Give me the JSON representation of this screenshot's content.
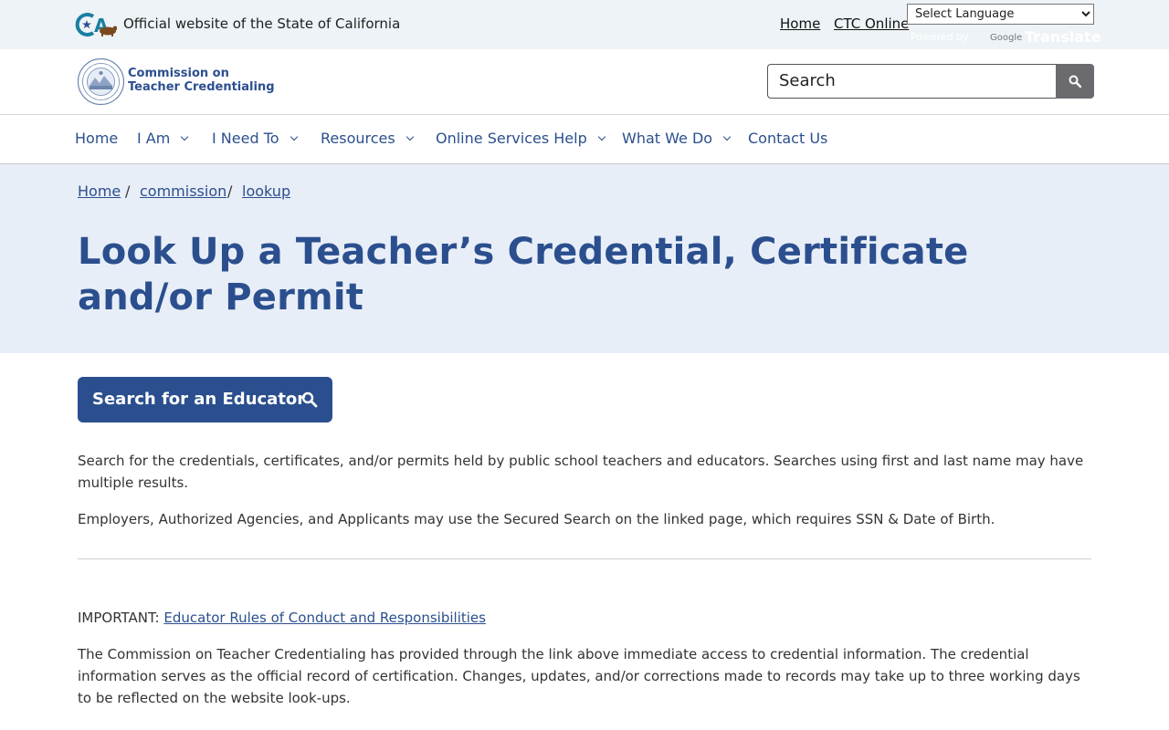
{
  "utility": {
    "ca_text": "Official website of the State of California",
    "links": [
      "Home",
      "CTC Online"
    ],
    "language_select": "Select Language",
    "powered_by": "Powered by",
    "google": "Google",
    "translate": "Translate"
  },
  "header": {
    "org_line1": "Commission on",
    "org_line2": "Teacher Credentialing",
    "search_placeholder": "Search"
  },
  "nav": {
    "items": [
      {
        "label": "Home",
        "dropdown": false
      },
      {
        "label": "I Am",
        "dropdown": true
      },
      {
        "label": "I Need To",
        "dropdown": true
      },
      {
        "label": "Resources",
        "dropdown": true
      },
      {
        "label": "Online Services Help",
        "dropdown": true
      },
      {
        "label": "What We Do",
        "dropdown": true
      },
      {
        "label": "Contact Us",
        "dropdown": false
      }
    ]
  },
  "breadcrumb": [
    "Home",
    "commission",
    "lookup"
  ],
  "page_title": "Look Up a Teacher’s Credential, Certificate and/or Permit",
  "cta": {
    "label": "Search for an Educator"
  },
  "content": {
    "para1": "Search for the credentials, certificates, and/or permits held by public school teachers and educators. Searches using first and last name may have multiple results.",
    "para2": "Employers, Authorized Agencies, and Applicants may use the Secured Search on the linked page, which requires SSN & Date of Birth.",
    "important_label": "IMPORTANT:",
    "important_link": "Educator Rules of Conduct and Responsibilities",
    "para3": "The Commission on Teacher Credentialing has provided through the link above immediate access to credential information. The credential information serves as the official record of certification. Changes, updates, and/or corrections made to records may take up to three working days to be reflected on the website look-ups."
  },
  "colors": {
    "brand_blue": "#2b4f8e",
    "hero_bg": "#e8eef7",
    "utility_bg": "#eef3f7",
    "search_button": "#6a6a6f"
  }
}
